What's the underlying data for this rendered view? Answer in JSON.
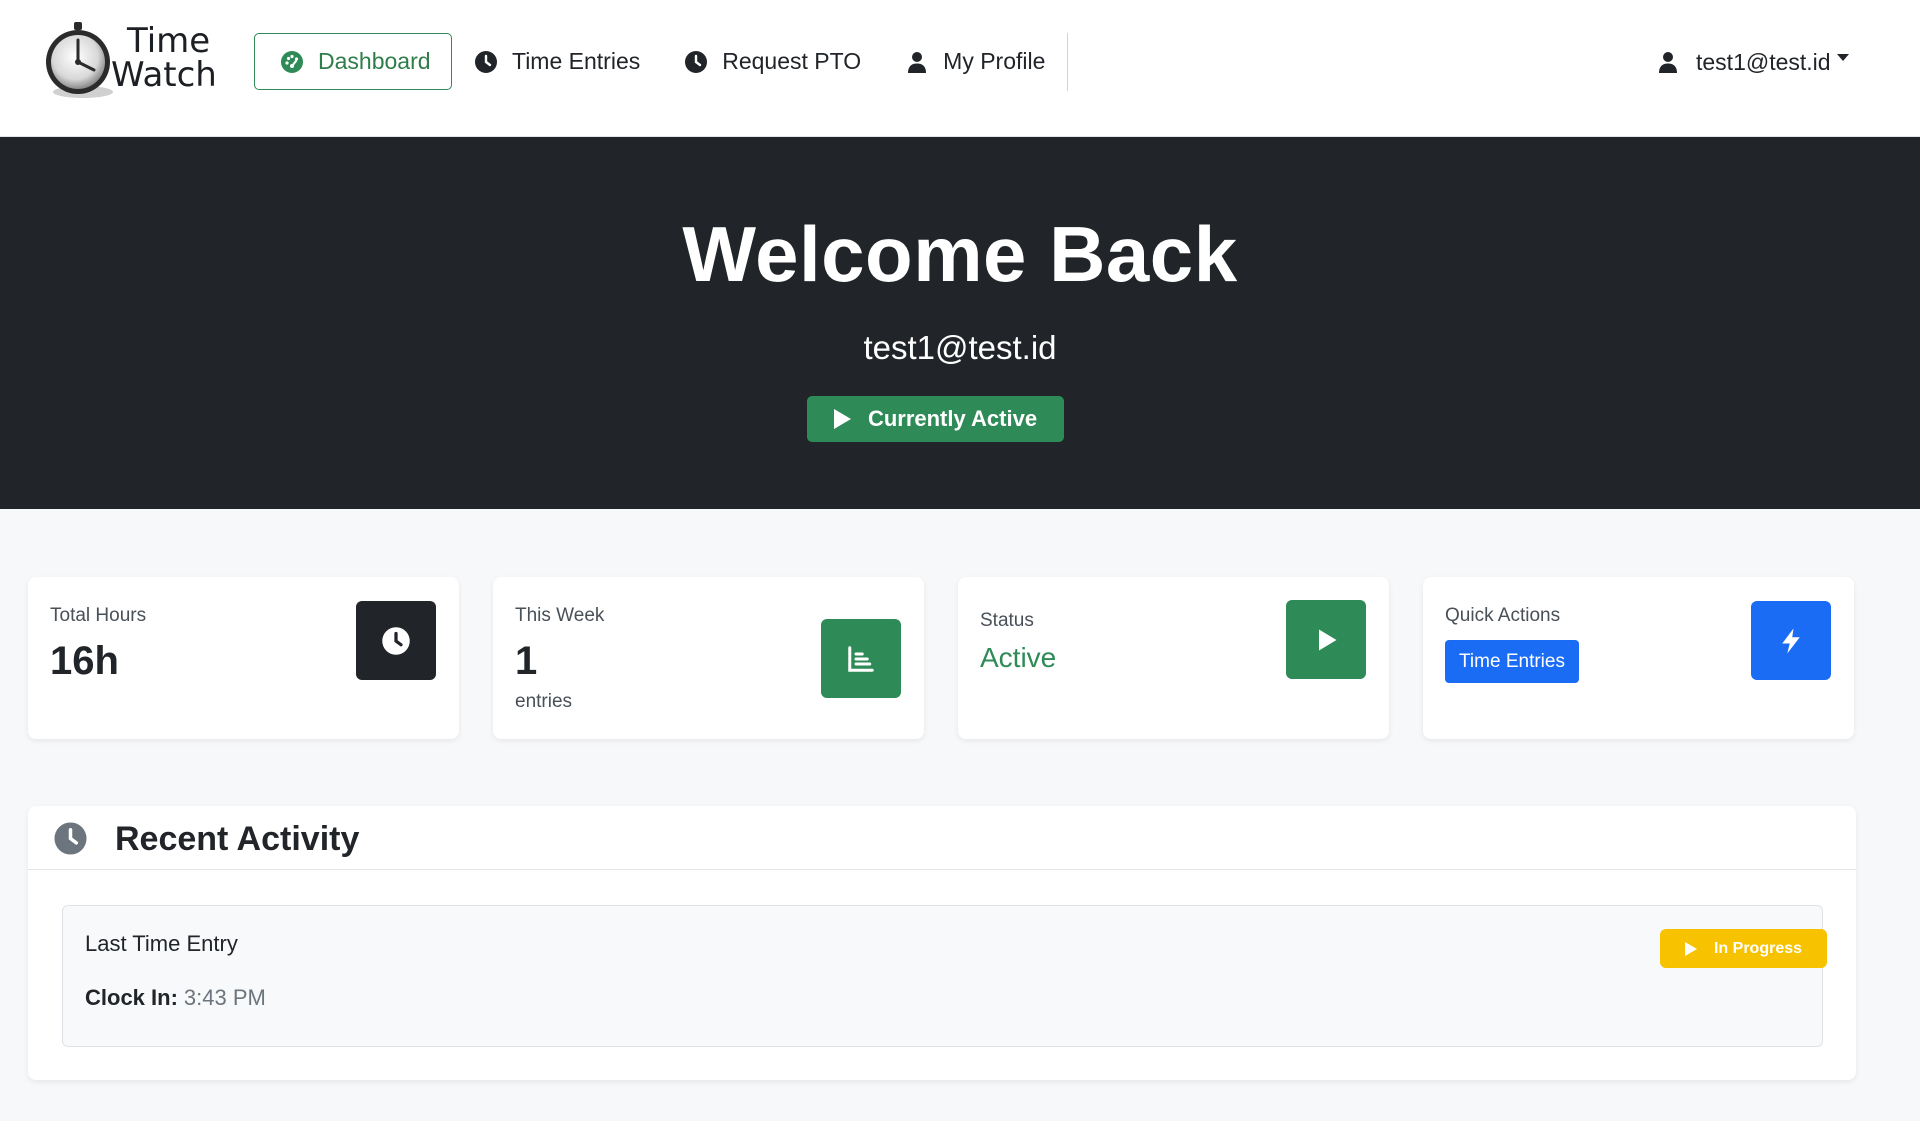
{
  "brand": {
    "line1": "Time",
    "line2": "Watch"
  },
  "nav": {
    "items": [
      {
        "label": "Dashboard",
        "icon": "dashboard-gauge-icon",
        "active": true
      },
      {
        "label": "Time Entries",
        "icon": "clock-icon"
      },
      {
        "label": "Request PTO",
        "icon": "clock-icon"
      },
      {
        "label": "My Profile",
        "icon": "user-icon"
      }
    ]
  },
  "user_menu": {
    "email": "test1@test.id",
    "icon": "user-icon"
  },
  "hero": {
    "title": "Welcome Back",
    "subtitle": "test1@test.id",
    "status": "Currently Active"
  },
  "cards": {
    "total_hours": {
      "label": "Total Hours",
      "value": "16h",
      "icon": "clock-icon",
      "tile_color": "#212529"
    },
    "this_week": {
      "label": "This Week",
      "value": "1",
      "foot": "entries",
      "icon": "bar-chart-icon",
      "tile_color": "#2e8b57"
    },
    "status": {
      "label": "Status",
      "value": "Active",
      "icon": "play-icon",
      "tile_color": "#2e8b57"
    },
    "quick_actions": {
      "label": "Quick Actions",
      "button": "Time Entries",
      "icon": "bolt-icon",
      "tile_color": "#1a6cf5"
    }
  },
  "activity": {
    "title": "Recent Activity",
    "entry": {
      "title": "Last Time Entry",
      "clock_in_label": "Clock In:",
      "clock_in_value": "3:43 PM",
      "badge": "In Progress"
    }
  },
  "colors": {
    "accent_green": "#2e8b57",
    "primary_blue": "#1a6cf5",
    "warning_yellow": "#f7c200",
    "dark": "#212529"
  }
}
